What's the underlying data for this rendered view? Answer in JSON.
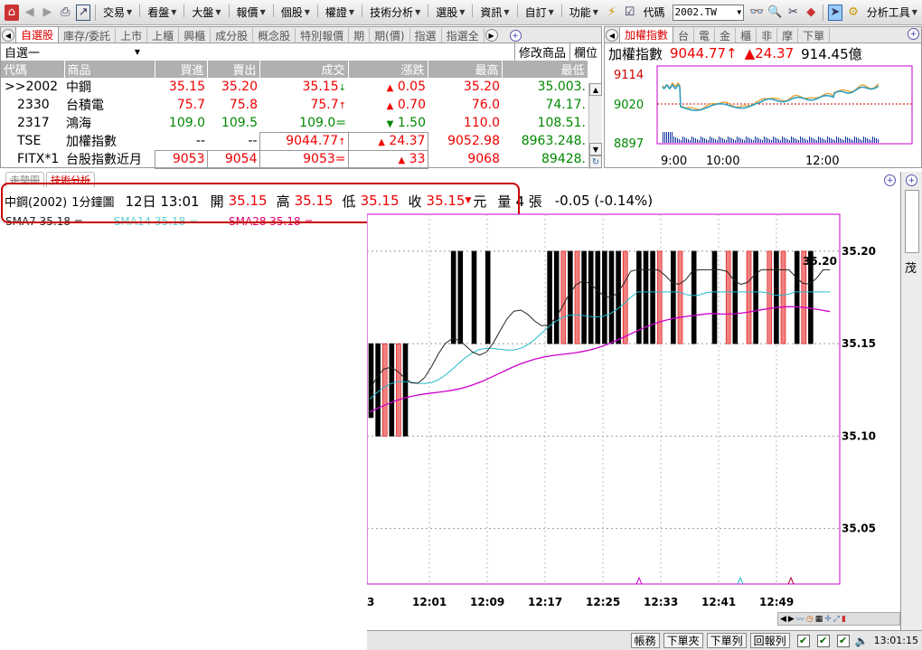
{
  "toolbar": {
    "menus": [
      "交易",
      "看盤",
      "大盤",
      "報價",
      "個股",
      "權證",
      "技術分析",
      "選股",
      "資訊",
      "自訂",
      "功能"
    ],
    "code_label": "代碼",
    "code_value": "2002.TW",
    "analysis_tools": "分析工具"
  },
  "quote_panel": {
    "tabs": [
      "自選股",
      "庫存/委託",
      "上市",
      "上櫃",
      "興櫃",
      "成分股",
      "概念股",
      "特別報價",
      "期",
      "期(價)",
      "指選",
      "指選全"
    ],
    "group_name": "自選一",
    "edit_label": "修改商品",
    "column_label": "欄位",
    "columns": [
      "代碼",
      "商品",
      "買進",
      "賣出",
      "成交",
      "漲跌",
      "最高",
      "最低"
    ],
    "rows": [
      {
        "code": ">>2002",
        "name": "中鋼",
        "bid": "35.15",
        "ask": "35.20",
        "last": "35.15",
        "last_mark": "↓",
        "chg_mark": "▲",
        "change": "0.05",
        "high": "35.20",
        "low": "35.003."
      },
      {
        "code": "2330",
        "name": "台積電",
        "bid": "75.7",
        "ask": "75.8",
        "last": "75.7",
        "last_mark": "↑",
        "chg_mark": "▲",
        "change": "0.70",
        "high": "76.0",
        "low": "74.17."
      },
      {
        "code": "2317",
        "name": "鴻海",
        "bid": "109.0",
        "ask": "109.5",
        "last": "109.0",
        "last_mark": "=",
        "chg_mark": "▼",
        "change": "1.50",
        "high": "110.0",
        "low": "108.51."
      },
      {
        "code": "TSE",
        "name": "加權指數",
        "bid": "--",
        "ask": "--",
        "last": "9044.77",
        "last_mark": "↑",
        "chg_mark": "▲",
        "change": "24.37",
        "high": "9052.98",
        "low": "8963.248."
      },
      {
        "code": "FITX*1",
        "name": "台股指數近月",
        "bid": "9053",
        "ask": "9054",
        "last": "9053",
        "last_mark": "=",
        "chg_mark": "▲",
        "change": "33",
        "high": "9068",
        "low": "89428."
      }
    ]
  },
  "index_panel": {
    "tabs": [
      "加權指數",
      "台",
      "電",
      "金",
      "櫃",
      "非",
      "摩",
      "下單"
    ],
    "name": "加權指數",
    "value": "9044.77",
    "value_mark": "↑",
    "change_mark": "▲",
    "change": "24.37",
    "volume": "914.45億",
    "y_labels": [
      "9114",
      "9020",
      "8897"
    ],
    "x_labels": [
      "9:00",
      "10:00",
      "12:00"
    ]
  },
  "lower": {
    "tabs": [
      "走勢圖",
      "技術分析"
    ],
    "info": {
      "name": "中鋼(2002)",
      "period": "1分鐘圖",
      "date": "12日 13:01",
      "open_label": "開",
      "open": "35.15",
      "high_label": "高",
      "high": "35.15",
      "low_label": "低",
      "low": "35.15",
      "close_label": "收",
      "close": "35.15",
      "unit": "元",
      "vol_label": "量",
      "vol": "4 張",
      "change": "-0.05 (-0.14%)"
    },
    "ma": [
      "SMA7 35.18 =",
      "SMA14 35.18 =",
      "SMA28 35.18 ="
    ],
    "right_labels": [
      "茂"
    ]
  },
  "chart_data": {
    "type": "bar",
    "title": "",
    "y_ticks": [
      "35.20",
      "35.15",
      "35.10",
      "35.05"
    ],
    "ylim": [
      35.02,
      35.22
    ],
    "x_ticks": [
      "3",
      "12:01",
      "12:09",
      "12:17",
      "12:25",
      "12:33",
      "12:41",
      "12:49"
    ],
    "max_label": "35.20",
    "bars": [
      {
        "i": 0,
        "o": 35.15,
        "c": 35.11,
        "up": false
      },
      {
        "i": 1,
        "o": 35.15,
        "c": 35.1,
        "up": false
      },
      {
        "i": 2,
        "o": 35.1,
        "c": 35.15,
        "up": true
      },
      {
        "i": 3,
        "o": 35.15,
        "c": 35.1,
        "up": false
      },
      {
        "i": 4,
        "o": 35.1,
        "c": 35.15,
        "up": true
      },
      {
        "i": 5,
        "o": 35.15,
        "c": 35.1,
        "up": false
      },
      {
        "i": 12,
        "o": 35.2,
        "c": 35.15,
        "up": false
      },
      {
        "i": 13,
        "o": 35.2,
        "c": 35.15,
        "up": false
      },
      {
        "i": 15,
        "o": 35.2,
        "c": 35.15,
        "up": false
      },
      {
        "i": 17,
        "o": 35.2,
        "c": 35.15,
        "up": false
      },
      {
        "i": 26,
        "o": 35.2,
        "c": 35.15,
        "up": false
      },
      {
        "i": 27,
        "o": 35.2,
        "c": 35.15,
        "up": false
      },
      {
        "i": 28,
        "o": 35.15,
        "c": 35.2,
        "up": true
      },
      {
        "i": 29,
        "o": 35.2,
        "c": 35.15,
        "up": false
      },
      {
        "i": 30,
        "o": 35.15,
        "c": 35.2,
        "up": true
      },
      {
        "i": 31,
        "o": 35.2,
        "c": 35.15,
        "up": false
      },
      {
        "i": 32,
        "o": 35.2,
        "c": 35.15,
        "up": false
      },
      {
        "i": 33,
        "o": 35.2,
        "c": 35.15,
        "up": false
      },
      {
        "i": 34,
        "o": 35.2,
        "c": 35.15,
        "up": false
      },
      {
        "i": 35,
        "o": 35.2,
        "c": 35.15,
        "up": false
      },
      {
        "i": 36,
        "o": 35.2,
        "c": 35.15,
        "up": false
      },
      {
        "i": 37,
        "o": 35.15,
        "c": 35.2,
        "up": true
      },
      {
        "i": 39,
        "o": 35.2,
        "c": 35.15,
        "up": false
      },
      {
        "i": 40,
        "o": 35.2,
        "c": 35.15,
        "up": false
      },
      {
        "i": 41,
        "o": 35.2,
        "c": 35.15,
        "up": false
      },
      {
        "i": 42,
        "o": 35.15,
        "c": 35.2,
        "up": true
      },
      {
        "i": 44,
        "o": 35.2,
        "c": 35.15,
        "up": false
      },
      {
        "i": 45,
        "o": 35.15,
        "c": 35.2,
        "up": true
      },
      {
        "i": 47,
        "o": 35.2,
        "c": 35.15,
        "up": false
      },
      {
        "i": 50,
        "o": 35.2,
        "c": 35.15,
        "up": false
      },
      {
        "i": 52,
        "o": 35.15,
        "c": 35.2,
        "up": true
      },
      {
        "i": 53,
        "o": 35.2,
        "c": 35.15,
        "up": false
      },
      {
        "i": 55,
        "o": 35.15,
        "c": 35.2,
        "up": true
      },
      {
        "i": 56,
        "o": 35.2,
        "c": 35.15,
        "up": false
      },
      {
        "i": 58,
        "o": 35.15,
        "c": 35.2,
        "up": true
      },
      {
        "i": 59,
        "o": 35.2,
        "c": 35.15,
        "up": false
      },
      {
        "i": 60,
        "o": 35.15,
        "c": 35.2,
        "up": true
      },
      {
        "i": 62,
        "o": 35.2,
        "c": 35.15,
        "up": false
      },
      {
        "i": 63,
        "o": 35.15,
        "c": 35.2,
        "up": true
      },
      {
        "i": 64,
        "o": 35.2,
        "c": 35.15,
        "up": false
      }
    ]
  },
  "status": {
    "buttons": [
      "帳務",
      "下單夾",
      "下單列",
      "回報列"
    ],
    "time": "13:01:15"
  }
}
